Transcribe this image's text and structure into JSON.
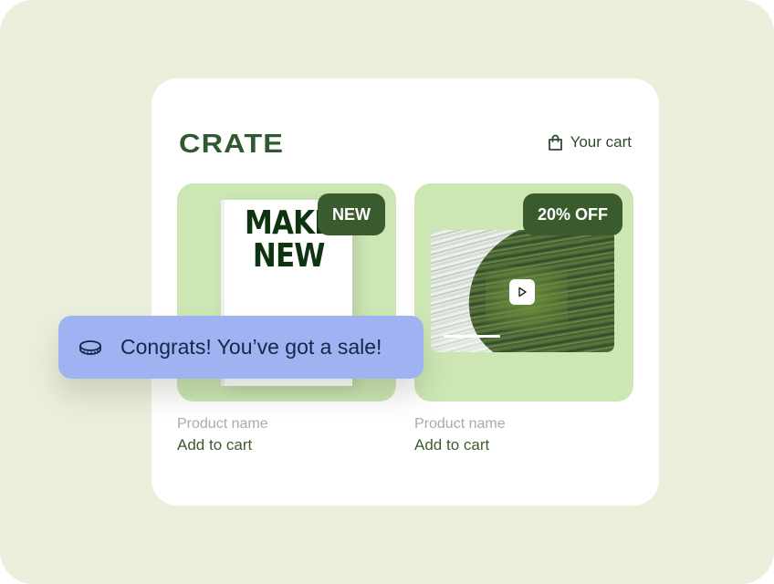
{
  "store": {
    "brand": "CRATE",
    "cart_label": "Your cart"
  },
  "products": [
    {
      "badge": "NEW",
      "cover_title_line1": "MAKE",
      "cover_title_line2": "NEW",
      "name": "Product name",
      "action": "Add to cart"
    },
    {
      "badge": "20% OFF",
      "name": "Product name",
      "action": "Add to cart"
    }
  ],
  "toast": {
    "message": "Congrats! You’ve got a sale!",
    "icon": "coin-icon"
  },
  "colors": {
    "background": "#eaefdc",
    "tile": "#cce6b4",
    "badge": "#3a5b2e",
    "brand": "#2f5a2f",
    "toast": "#9fb3f3"
  }
}
